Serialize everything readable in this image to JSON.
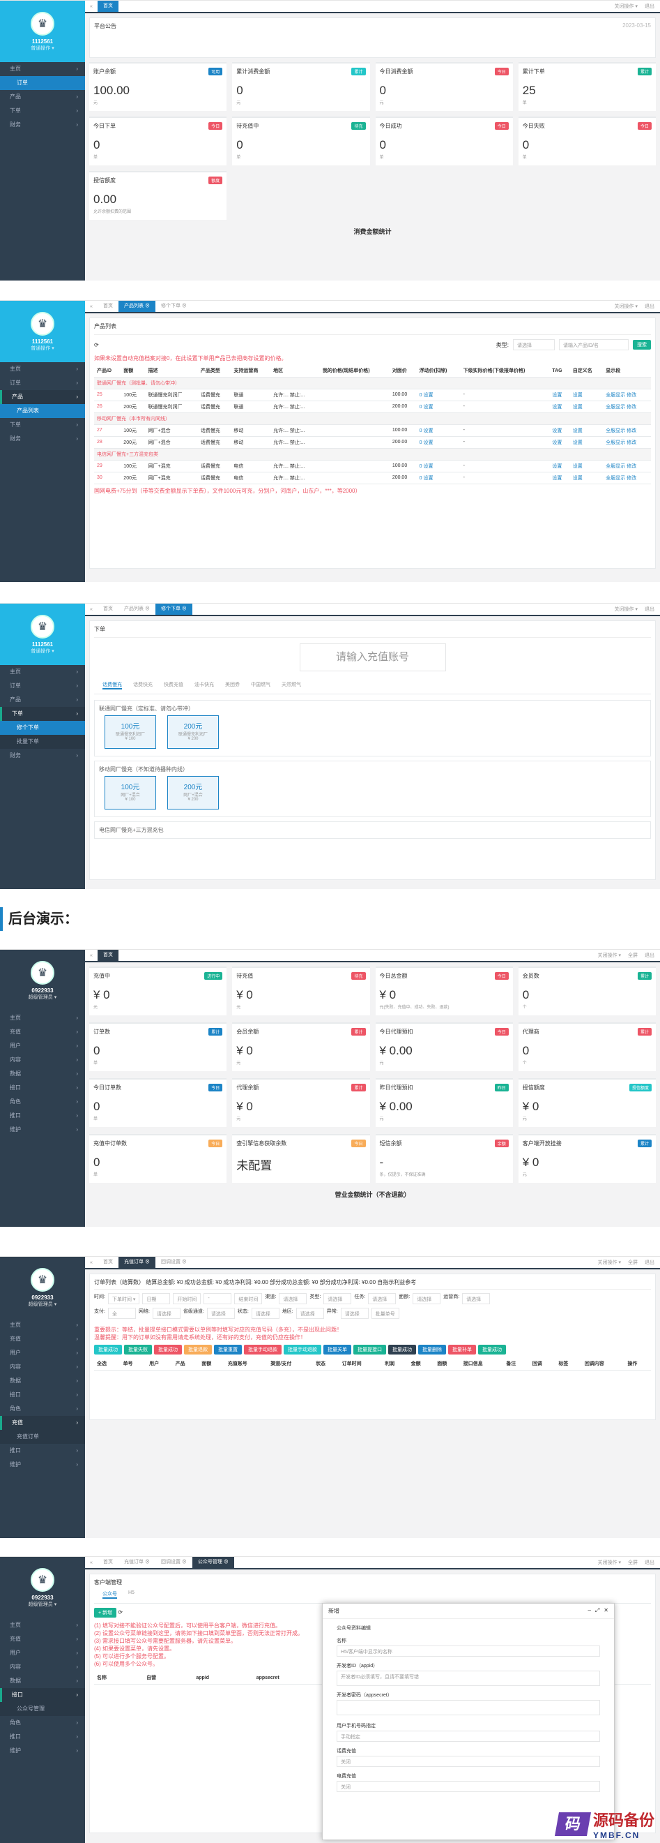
{
  "s1": {
    "user": "1112561",
    "role": "普通操作 ▾",
    "nav": [
      "主页",
      "订单",
      "产品",
      "下单",
      "财务"
    ],
    "tabs": [
      "首页"
    ],
    "tabs_right": [
      "关闭操作 ▾",
      "退出"
    ],
    "notice_title": "平台公告",
    "notice_date": "2023-03-15",
    "cards": [
      {
        "t": "账户余额",
        "b": "可用",
        "bc": "#1c84c6",
        "v": "100.00",
        "s": "元"
      },
      {
        "t": "累计消费金额",
        "b": "累计",
        "bc": "#23c6c8",
        "v": "0",
        "s": "元"
      },
      {
        "t": "今日消费金额",
        "b": "今日",
        "bc": "#ed5565",
        "v": "0",
        "s": "元"
      },
      {
        "t": "累计下单",
        "b": "累计",
        "bc": "#1ab394",
        "v": "25",
        "s": "单"
      },
      {
        "t": "今日下单",
        "b": "今日",
        "bc": "#ed5565",
        "v": "0",
        "s": "单"
      },
      {
        "t": "待充值中",
        "b": "待充",
        "bc": "#1ab394",
        "v": "0",
        "s": "单"
      },
      {
        "t": "今日成功",
        "b": "今日",
        "bc": "#ed5565",
        "v": "0",
        "s": "单"
      },
      {
        "t": "今日失败",
        "b": "今日",
        "bc": "#ed5565",
        "v": "0",
        "s": "单"
      },
      {
        "t": "授信额度",
        "b": "额度",
        "bc": "#ed5565",
        "v": "0.00",
        "s": "允许余额扣费的范围"
      }
    ],
    "caption": "消费金额统计"
  },
  "s2": {
    "user": "1112561",
    "role": "普通操作 ▾",
    "nav": [
      "主页",
      "订单",
      "产品",
      "产品列表",
      "下单",
      "财务"
    ],
    "tabs": [
      "首页",
      "产品列表 ⊗",
      "修个下单 ⊗"
    ],
    "tabs_right": [
      "关闭操作 ▾",
      "退出"
    ],
    "title": "产品列表",
    "type_label": "类型:",
    "type_val": "请选择",
    "search_ph": "请输入产品ID/名",
    "search_btn": "搜索",
    "tip": "如果未设置自动充值档案对接0，在此设置下单用产品已去把商存设置的价格。",
    "headers": [
      "产品ID",
      "面额",
      "描述",
      "产品类型",
      "支持运营商",
      "地区",
      "我的价格(现结单价格)",
      "对面价",
      "浮动价(扣除)",
      "下级实际价格(下级报单价格)",
      "TAG",
      "自定义名",
      "显示段"
    ],
    "groups": [
      {
        "name": "联通网厂慢充（测批量、请勿心带冲）",
        "rows": [
          [
            "25",
            "100元",
            "联通慢充利润厂",
            "话费慢充",
            "联通",
            "允许:... 禁止:...",
            "",
            "100.00",
            "0 设置",
            "-",
            "设置",
            "设置",
            "全服显示 修改"
          ],
          [
            "26",
            "200元",
            "联通慢充利润厂",
            "话费慢充",
            "联通",
            "允许:... 禁止:...",
            "",
            "200.00",
            "0 设置",
            "-",
            "设置",
            "设置",
            "全服显示 修改"
          ]
        ]
      },
      {
        "name": "移动网厂慢充（本市所有内同线）",
        "rows": [
          [
            "27",
            "100元",
            "网厂+混合",
            "话费慢充",
            "移动",
            "允许:... 禁止:...",
            "",
            "100.00",
            "0 设置",
            "-",
            "设置",
            "设置",
            "全服显示 修改"
          ],
          [
            "28",
            "200元",
            "网厂+混合",
            "话费慢充",
            "移动",
            "允许:... 禁止:...",
            "",
            "200.00",
            "0 设置",
            "-",
            "设置",
            "设置",
            "全服显示 修改"
          ]
        ]
      },
      {
        "name": "电信网厂慢充+三方混充包类",
        "rows": [
          [
            "29",
            "100元",
            "网厂+混充",
            "话费慢充",
            "电信",
            "允许:... 禁止:...",
            "",
            "100.00",
            "0 设置",
            "-",
            "设置",
            "设置",
            "全服显示 修改"
          ],
          [
            "30",
            "200元",
            "网厂+混充",
            "话费慢充",
            "电信",
            "允许:... 禁止:...",
            "",
            "200.00",
            "0 设置",
            "-",
            "设置",
            "设置",
            "全服显示 修改"
          ]
        ]
      }
    ],
    "foot": "国网电费+75分到（带等交费金额显示下单费），文件1000元可充，分别户，河南户，山东户，***，等2000）"
  },
  "s3": {
    "user": "1112561",
    "role": "普通操作 ▾",
    "nav": [
      "主页",
      "订单",
      "产品",
      "下单",
      "修个下单",
      "批量下单",
      "财务"
    ],
    "tabs": [
      "首页",
      "产品列表 ⊗",
      "修个下单 ⊗"
    ],
    "tabs_right": [
      "关闭操作 ▾",
      "退出"
    ],
    "title": "下单",
    "input_ph": "请输入充值账号",
    "subtabs": [
      "话费慢充",
      "话费快充",
      "快费充值",
      "油卡快充",
      "美团券",
      "中国燃气",
      "天然燃气"
    ],
    "p1_title": "联通网厂慢充（定标准、请勿心带冲）",
    "p1": [
      {
        "v": "100元",
        "d": "联通慢充利润厂",
        "p": "¥ 100"
      },
      {
        "v": "200元",
        "d": "联通慢充利润厂",
        "p": "¥ 200"
      }
    ],
    "p2_title": "移动网厂慢充（不知道待播种内线）",
    "p2": [
      {
        "v": "100元",
        "d": "网厂+混合",
        "p": "¥ 100"
      },
      {
        "v": "200元",
        "d": "网厂+混合",
        "p": "¥ 200"
      }
    ],
    "p3_title": "电信网厂慢充+三方混充包"
  },
  "heading": "后台演示：",
  "s4": {
    "user": "0922933",
    "role": "超级管理员 ▾",
    "nav": [
      "主页",
      "充值",
      "用户",
      "内容",
      "数据",
      "接口",
      "角色",
      "推口",
      "维护"
    ],
    "tabs": [
      "首页"
    ],
    "tabs_right": [
      "关闭操作 ▾",
      "全屏",
      "退出"
    ],
    "cards": [
      {
        "t": "充值中",
        "b": "进行中",
        "bc": "#1ab394",
        "v": "¥ 0",
        "s": "元"
      },
      {
        "t": "待充值",
        "b": "待充",
        "bc": "#ed5565",
        "v": "¥ 0",
        "s": "元"
      },
      {
        "t": "今日总金额",
        "b": "今日",
        "bc": "#ed5565",
        "v": "¥ 0",
        "s": "元(失败、充值中、成功、失败、退款)"
      },
      {
        "t": "会员数",
        "b": "累计",
        "bc": "#1ab394",
        "v": "0",
        "s": "个"
      },
      {
        "t": "订单数",
        "b": "累计",
        "bc": "#1c84c6",
        "v": "0",
        "s": "单"
      },
      {
        "t": "会员余额",
        "b": "累计",
        "bc": "#ed5565",
        "v": "¥ 0",
        "s": "元"
      },
      {
        "t": "今日代理预扣",
        "b": "今日",
        "bc": "#ed5565",
        "v": "¥ 0.00",
        "s": "元"
      },
      {
        "t": "代理商",
        "b": "累计",
        "bc": "#ed5565",
        "v": "0",
        "s": "个"
      },
      {
        "t": "今日订单数",
        "b": "今日",
        "bc": "#1c84c6",
        "v": "0",
        "s": "单"
      },
      {
        "t": "代理余额",
        "b": "累计",
        "bc": "#ed5565",
        "v": "¥ 0",
        "s": "元"
      },
      {
        "t": "昨日代理预扣",
        "b": "昨日",
        "bc": "#1ab394",
        "v": "¥ 0.00",
        "s": "元"
      },
      {
        "t": "授信额度",
        "b": "授信额度",
        "bc": "#23c6c8",
        "v": "¥ 0",
        "s": "元"
      },
      {
        "t": "充值中订单数",
        "b": "今日",
        "bc": "#f8ac59",
        "v": "0",
        "s": "单"
      },
      {
        "t": "查引擎信息获取余数",
        "b": "今日",
        "bc": "#f8ac59",
        "v": "未配置",
        "s": ""
      },
      {
        "t": "短信余额",
        "b": "余额",
        "bc": "#ed5565",
        "v": "-",
        "s": "条，仅提示，不保证准确"
      },
      {
        "t": "客户端开放挂接",
        "b": "累计",
        "bc": "#1c84c6",
        "v": "¥ 0",
        "s": "元"
      }
    ],
    "caption": "营业金额统计（不含退款）"
  },
  "s5": {
    "user": "0922933",
    "role": "超级管理员 ▾",
    "nav": [
      "主页",
      "充值",
      "用户",
      "内容",
      "数据",
      "接口",
      "角色",
      "充值",
      "充值订单",
      "推口",
      "维护"
    ],
    "tabs": [
      "首页",
      "充值订单 ⊗",
      "回调设置 ⊗"
    ],
    "tabs_right": [
      "关闭操作 ▾",
      "全屏",
      "退出"
    ],
    "summary": "订单列表（结算数）  结算总金额: ¥0  成功总金额: ¥0  成功净利润: ¥0.00  部分成功总金额: ¥0  部分成功净利润: ¥0.00  自指示利益参考",
    "filters1": [
      "时间:",
      "下单时间 ▾",
      "日期",
      "开始时间",
      "-",
      "结束时间",
      "渠道:",
      "请选择",
      "类型:",
      "请选择",
      "任务:",
      "请选择",
      "面额:",
      "请选择",
      "运营商:",
      "请选择"
    ],
    "filters2": [
      "支付:",
      "全",
      "网络:",
      "请选择",
      "省级通道:",
      "请选择",
      "状态:",
      "请选择",
      "地区:",
      "请选择",
      "异常:",
      "请选择",
      "批量单号"
    ],
    "tip": "重要提示：等结，批量提单接口模式需要以单例等时填写对应的充值号码（多充），不是出现此问题！",
    "tip2": "温馨提醒：用下的订单如没有需用请走系统处理，还有好的支付，充值的仍应在操作！",
    "actions": [
      "批量成功",
      "批量失败",
      "批量成功",
      "批量退款",
      "批量重置",
      "批量手动退款",
      "批量手动退款",
      "批量关单",
      "批量提接口",
      "批量成功",
      "批量删除",
      "批量补单",
      "批量成功"
    ],
    "headers": [
      "全选",
      "单号",
      "用户",
      "产品",
      "面额",
      "充值账号",
      "渠道/支付",
      "状态",
      "订单时间",
      "利润",
      "金额",
      "面额",
      "接口信息",
      "备注",
      "回调",
      "标签",
      "回调内容",
      "操作"
    ]
  },
  "s6": {
    "user": "0922933",
    "role": "超级管理员 ▾",
    "nav": [
      "主页",
      "充值",
      "用户",
      "内容",
      "数据",
      "接口",
      "公众号管理",
      "角色",
      "推口",
      "维护"
    ],
    "tabs": [
      "首页",
      "充值订单 ⊗",
      "回调设置 ⊗",
      "公众号管理 ⊗"
    ],
    "tabs_right": [
      "关闭操作 ▾",
      "全屏",
      "退出"
    ],
    "title": "客户端管理",
    "subtabs": [
      "公众号",
      "H5"
    ],
    "add_btn": "+ 新增",
    "notes": [
      "(1) 填写对接不能验证公众号配置后，可以使用平台客户端，微信进行充值。",
      "(2) 设置公众号菜单链接到这里，请将如下接口填到菜单里面，否则无法正常打开成。",
      "(3) 需求接口填写公众号需要配置服务器，请先设置菜单。",
      "(4) 如果要设置菜单，请先设置。",
      "(5) 可以进行多个服务号配置。",
      "(6) 可以使用多个公众号。"
    ],
    "headers": [
      "名称",
      "自营",
      "appid",
      "appsecret",
      "token",
      "encodingaeskey",
      "",
      "",
      "",
      "操作"
    ],
    "modal": {
      "title": "新增",
      "section": "公众号资料编辑",
      "f1": "名称",
      "f1ph": "H5/客户端中显示的名称",
      "f2": "开发者ID（appid）",
      "f2ph": "开发者ID必须填写，且请不要填写错",
      "f3": "开发者密码（appsecret）",
      "f4": "用户手机号码指定",
      "f4v": "手动指定",
      "f5": "话费充值",
      "f5v": "关闭",
      "f6": "电费充值",
      "f6v": "关闭"
    }
  },
  "watermark": {
    "icon": "码",
    "t1": "源码备份",
    "t2": "YMBF.CN"
  }
}
